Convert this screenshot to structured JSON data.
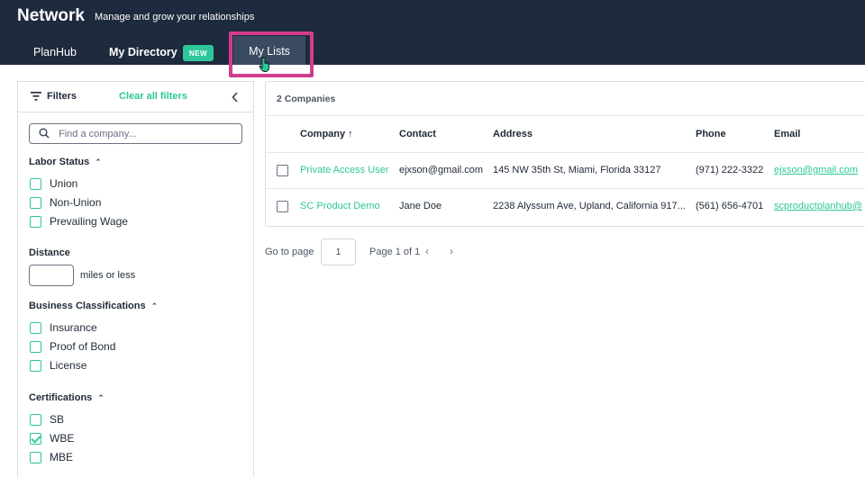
{
  "header": {
    "brand": "Network",
    "tagline": "Manage and grow your relationships",
    "tabs": [
      {
        "label": "PlanHub"
      },
      {
        "label": "My Directory",
        "badge": "NEW"
      },
      {
        "label": "My Lists"
      }
    ]
  },
  "filters": {
    "title": "Filters",
    "clear_all": "Clear all filters",
    "search_placeholder": "Find a company...",
    "labor_status": {
      "title": "Labor Status",
      "options": [
        {
          "label": "Union",
          "checked": false
        },
        {
          "label": "Non-Union",
          "checked": false
        },
        {
          "label": "Prevailing Wage",
          "checked": false
        }
      ]
    },
    "distance": {
      "title": "Distance",
      "value": "",
      "unit_label": "miles or less"
    },
    "business_classifications": {
      "title": "Business Classifications",
      "options": [
        {
          "label": "Insurance",
          "checked": false
        },
        {
          "label": "Proof of Bond",
          "checked": false
        },
        {
          "label": "License",
          "checked": false
        }
      ]
    },
    "certifications": {
      "title": "Certifications",
      "options": [
        {
          "label": "SB",
          "checked": false
        },
        {
          "label": "WBE",
          "checked": true
        },
        {
          "label": "MBE",
          "checked": false
        }
      ]
    }
  },
  "results": {
    "count": "2 Companies",
    "columns": [
      "Company ↑",
      "Contact",
      "Address",
      "Phone",
      "Email"
    ],
    "rows": [
      {
        "company": "Private Access User",
        "contact": "ejxson@gmail.com",
        "address": "145 NW 35th St, Miami, Florida 33127",
        "phone": "(971) 222-3322",
        "email": "ejxson@gmail.com"
      },
      {
        "company": "SC Product Demo",
        "contact": "Jane Doe",
        "address": "2238 Alyssum Ave, Upland, California 917...",
        "phone": "(561) 656-4701",
        "email": "scproductplanhub@"
      }
    ]
  },
  "pagination": {
    "goto_label": "Go to page",
    "page_value": "1",
    "info": "Page 1 of 1",
    "prev": "‹",
    "next": "›"
  },
  "colors": {
    "header_bg": "#1e2a3d",
    "accent": "#2ec79a",
    "highlight": "#d23d8d"
  }
}
